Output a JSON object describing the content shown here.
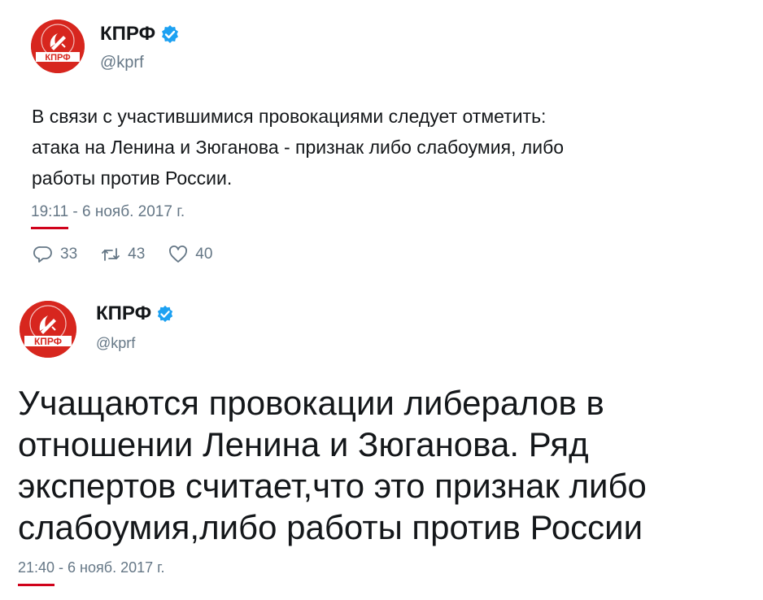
{
  "tweets": [
    {
      "name": "КПРФ",
      "handle": "@kprf",
      "avatar_text": "КПРФ",
      "text": "В связи с участившимися провокациями следует отметить:\nатака на Ленина и Зюганова - признак либо слабоумия, либо\nработы против России.",
      "time": "19:11",
      "date_sep": " - ",
      "date": "6 нояб. 2017 г.",
      "replies": "33",
      "retweets": "43",
      "likes": "40"
    },
    {
      "name": "КПРФ",
      "handle": "@kprf",
      "avatar_text": "КПРФ",
      "text": "Учащаются провокации либералов в\nотношении Ленина и Зюганова. Ряд\nэкспертов считает,что это признак либо\nслабоумия,либо работы против России",
      "time": "21:40",
      "date_sep": " - ",
      "date": "6 нояб. 2017 г."
    }
  ],
  "colors": {
    "verified": "#1da1f2",
    "avatar_red": "#d7261e",
    "underline": "#d0021b",
    "muted": "#657786"
  },
  "icons": {
    "reply": "reply-icon",
    "retweet": "retweet-icon",
    "like": "heart-icon",
    "verified": "verified-badge-icon"
  }
}
